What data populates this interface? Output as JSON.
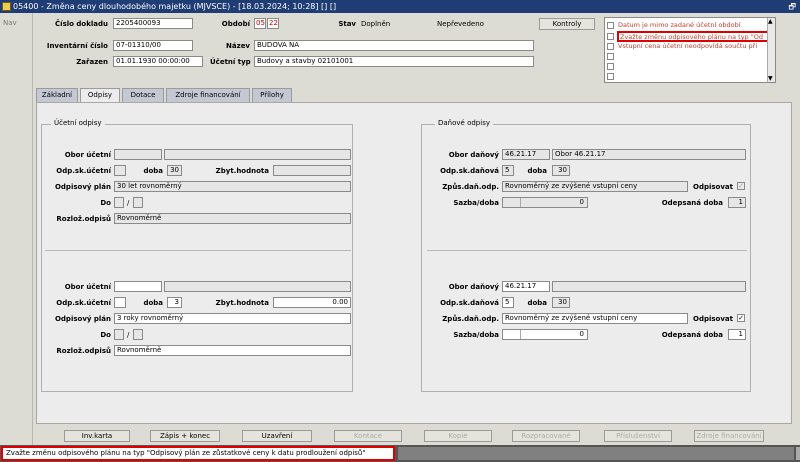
{
  "window": {
    "title": "05400 - Změna ceny dlouhodobého majetku (MJVSCE) - [18.03.2024; 10:28] [] []",
    "restore_glyph": "🗗"
  },
  "nav": {
    "label": "Nav"
  },
  "header": {
    "cislo_dokladu_label": "Číslo dokladu",
    "cislo_dokladu": "2205400093",
    "obdobi_label": "Období",
    "obdobi_month": "05",
    "obdobi_year": "22",
    "stav_label": "Stav",
    "stav_value": "Doplněn",
    "stav2_value": "Nepřevedeno",
    "inventarni_label": "Inventární číslo",
    "inventarni": "07-01310/00",
    "nazev_label": "Název",
    "nazev": "BUDOVA NA",
    "zarazen_label": "Zařazen",
    "zarazen": "01.01.1930 00:00:00",
    "ucetni_typ_label": "Účetní typ",
    "ucetni_typ": "Budovy a stavby 02101001",
    "kontroly_button": "Kontroly"
  },
  "messages": [
    {
      "text": "Datum je mimo zadané účetní období"
    },
    {
      "text": "Zvažte změnu odpisového plánu na typ \"Od"
    },
    {
      "text": "Vstupní cena účetní neodpovídá součtu při"
    },
    {
      "text": ""
    },
    {
      "text": ""
    },
    {
      "text": ""
    }
  ],
  "tabs": [
    {
      "label": "Základní"
    },
    {
      "label": "Odpisy"
    },
    {
      "label": "Dotace"
    },
    {
      "label": "Zdroje financování"
    },
    {
      "label": "Přílohy"
    }
  ],
  "ucetni": {
    "group_title": "Účetní odpisy",
    "top": {
      "obor_label": "Obor účetní",
      "obor_code": "",
      "obor_name": "",
      "odpsk_label": "Odp.sk.účetní",
      "odpsk": "",
      "doba_label": "doba",
      "doba": "30",
      "zbyt_label": "Zbyt.hodnota",
      "zbyt": "",
      "plan_label": "Odpisový plán",
      "plan": "30 let rovnoměrný",
      "do_label": "Do",
      "do_a": "",
      "do_sep": "/",
      "do_b": "",
      "rozloz_label": "Rozlož.odpisů",
      "rozloz": "Rovnoměrně"
    },
    "bottom": {
      "obor_label": "Obor účetní",
      "obor_code": "",
      "obor_name": "",
      "odpsk_label": "Odp.sk.účetní",
      "odpsk": "",
      "doba_label": "doba",
      "doba": "3",
      "zbyt_label": "Zbyt.hodnota",
      "zbyt": "0.00",
      "plan_label": "Odpisový plán",
      "plan": "3 roky rovnoměrný",
      "do_label": "Do",
      "do_a": "",
      "do_sep": "/",
      "do_b": "",
      "rozloz_label": "Rozlož.odpisů",
      "rozloz": "Rovnoměrně"
    }
  },
  "danove": {
    "group_title": "Daňové odpisy",
    "top": {
      "obor_label": "Obor daňový",
      "obor_code": "46.21.17",
      "obor_name": "Obor 46.21.17",
      "odpsk_label": "Odp.sk.daňová",
      "odpsk": "5",
      "doba_label": "doba",
      "doba": "30",
      "zpus_label": "Způs.daň.odp.",
      "zpus": "Rovnoměrný ze zvýšené vstupní ceny",
      "odpisovat_label": "Odpisovat",
      "odpisovat_mark": "✓",
      "sazba_label": "Sazba/doba",
      "sazba_a": "",
      "sazba_b": "0",
      "odepsana_label": "Odepsaná doba",
      "odepsana": "1"
    },
    "bottom": {
      "obor_label": "Obor daňový",
      "obor_code": "46.21.17",
      "obor_name": "",
      "odpsk_label": "Odp.sk.daňová",
      "odpsk": "5",
      "doba_label": "doba",
      "doba": "30",
      "zpus_label": "Způs.daň.odp.",
      "zpus": "Rovnoměrný ze zvýšené vstupní ceny",
      "odpisovat_label": "Odpisovat",
      "odpisovat_mark": "✓",
      "sazba_label": "Sazba/doba",
      "sazba_a": "",
      "sazba_b": "0",
      "odepsana_label": "Odepsaná doba",
      "odepsana": "1"
    }
  },
  "buttons": [
    {
      "label": "Inv.karta",
      "enabled": true
    },
    {
      "label": "Zápis + konec",
      "enabled": true
    },
    {
      "label": "Uzavření",
      "enabled": true
    },
    {
      "label": "Kontace",
      "enabled": false
    },
    {
      "label": "Kopie",
      "enabled": false
    },
    {
      "label": "Rozpracované",
      "enabled": false
    },
    {
      "label": "Příslušenství",
      "enabled": false
    },
    {
      "label": "Zdroje financování",
      "enabled": false
    }
  ],
  "status": {
    "text": "Zvažte změnu odpisového plánu na typ \"Odpisový plán ze zůstatkové ceny k datu prodloužení odpisů\""
  },
  "colors": {
    "titlebar": "#1f3c74",
    "warning_text": "#c00000",
    "highlight_border": "#e00000"
  }
}
